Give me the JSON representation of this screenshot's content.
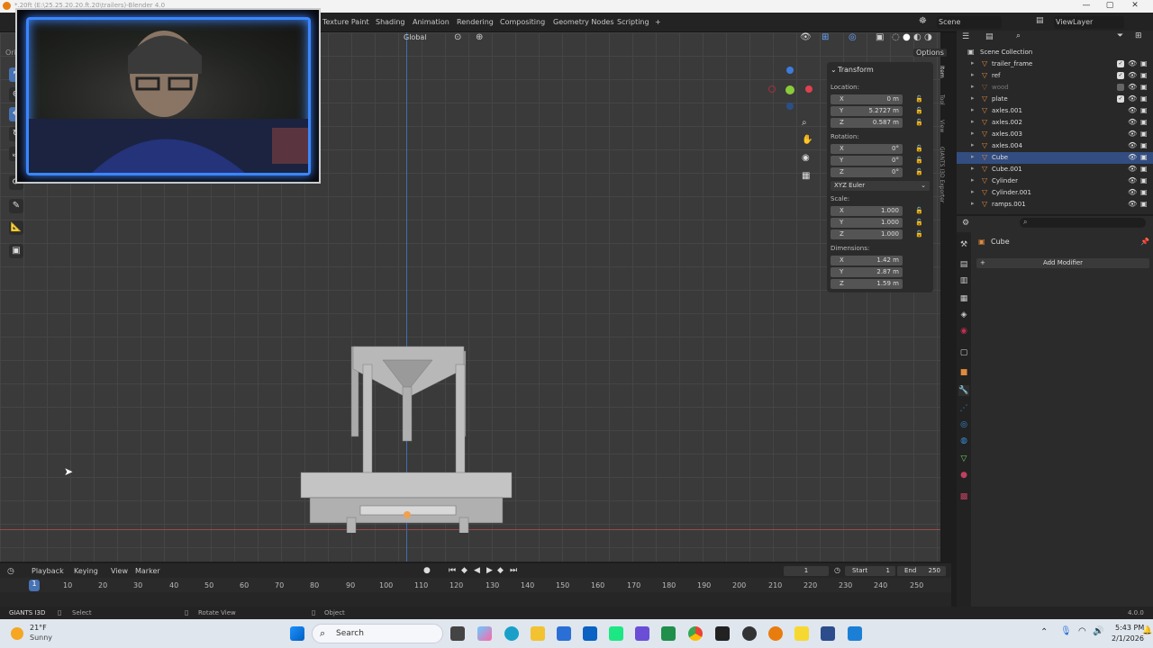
{
  "window": {
    "title": "*.20ft (E:\\25.25.20.20.ft.20\\trailers)-Blender 4.0",
    "controls": [
      "—",
      "▢",
      "✕"
    ]
  },
  "topbar": {
    "workspaces": [
      "Texture Paint",
      "Shading",
      "Animation",
      "Rendering",
      "Compositing",
      "Geometry Nodes",
      "Scripting",
      "+"
    ],
    "scene_label": "Scene",
    "viewlayer_label": "ViewLayer"
  },
  "viewport_header": {
    "orientation": "Global",
    "options": "Options",
    "left_label": "Ori"
  },
  "npanel": {
    "tab": "Transform",
    "location_label": "Location:",
    "location": [
      {
        "axis": "X",
        "value": "0 m"
      },
      {
        "axis": "Y",
        "value": "5.2727 m"
      },
      {
        "axis": "Z",
        "value": "0.587 m"
      }
    ],
    "rotation_label": "Rotation:",
    "rotation": [
      {
        "axis": "X",
        "value": "0°"
      },
      {
        "axis": "Y",
        "value": "0°"
      },
      {
        "axis": "Z",
        "value": "0°"
      }
    ],
    "rotation_mode": "XYZ Euler",
    "scale_label": "Scale:",
    "scale": [
      {
        "axis": "X",
        "value": "1.000"
      },
      {
        "axis": "Y",
        "value": "1.000"
      },
      {
        "axis": "Z",
        "value": "1.000"
      }
    ],
    "dimensions_label": "Dimensions:",
    "dimensions": [
      {
        "axis": "X",
        "value": "1.42 m"
      },
      {
        "axis": "Y",
        "value": "2.87 m"
      },
      {
        "axis": "Z",
        "value": "1.59 m"
      }
    ]
  },
  "sidetabs": [
    "Item",
    "Tool",
    "View",
    "GIANTS I3D Exporter"
  ],
  "outliner": {
    "root": "Scene Collection",
    "items": [
      "trailer_frame",
      "ref",
      "wood",
      "plate",
      "axles.001",
      "axles.002",
      "axles.003",
      "axles.004",
      "Cube",
      "Cube.001",
      "Cylinder",
      "Cylinder.001",
      "ramps.001"
    ]
  },
  "properties": {
    "object_name": "Cube",
    "add_modifier": "Add Modifier"
  },
  "timeline": {
    "menus": [
      "Playback",
      "Keying",
      "View",
      "Marker"
    ],
    "current_frame": "1",
    "start_label": "Start",
    "start": "1",
    "end_label": "End",
    "end": "250",
    "ticks": [
      "10",
      "20",
      "30",
      "40",
      "50",
      "60",
      "70",
      "80",
      "90",
      "100",
      "110",
      "120",
      "130",
      "140",
      "150",
      "160",
      "170",
      "180",
      "190",
      "200",
      "210",
      "220",
      "230",
      "240",
      "250"
    ],
    "playhead": "1"
  },
  "statusbar": {
    "addon": "GIANTS I3D",
    "select": "Select",
    "rotate": "Rotate View",
    "object": "Object",
    "version": "4.0.0"
  },
  "taskbar": {
    "temp": "21°F",
    "weather": "Sunny",
    "search": "Search",
    "time": "5:43 PM",
    "date": "2/1/2026"
  }
}
